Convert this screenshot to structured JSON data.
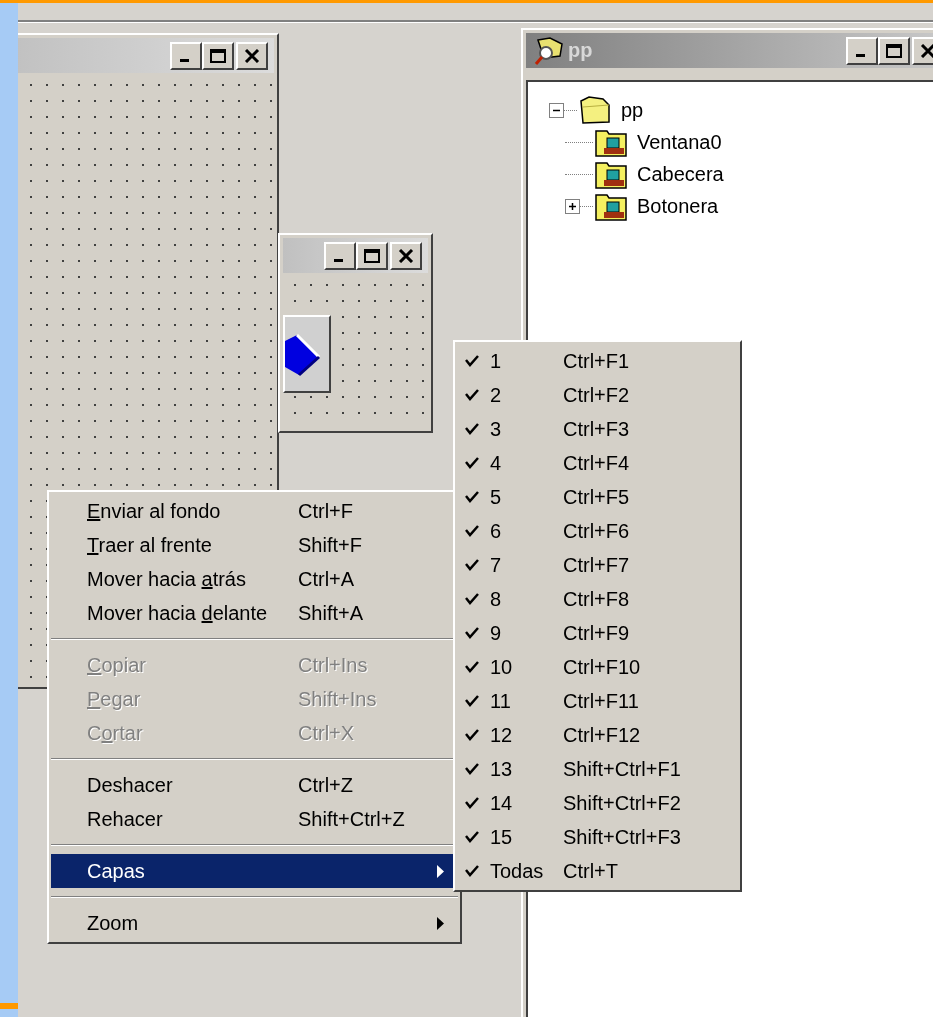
{
  "tree_window": {
    "title": "pp"
  },
  "tree": [
    {
      "label": "pp",
      "kind": "branch",
      "expanded": true,
      "children": [
        {
          "label": "Ventana0",
          "kind": "leaf"
        },
        {
          "label": "Cabecera",
          "kind": "leaf"
        },
        {
          "label": "Botonera",
          "kind": "branch",
          "expanded": false
        }
      ]
    }
  ],
  "menu": {
    "items": [
      {
        "kind": "item",
        "key": "E",
        "after": "nviar al fondo",
        "shortcut": "Ctrl+F",
        "disabled": false,
        "selected": false
      },
      {
        "kind": "item",
        "key": "T",
        "after": "raer al frente",
        "shortcut": "Shift+F",
        "disabled": false,
        "selected": false
      },
      {
        "kind": "item",
        "before": "Mover hacia ",
        "key": "a",
        "after": "trás",
        "shortcut": "Ctrl+A",
        "disabled": false,
        "selected": false
      },
      {
        "kind": "item",
        "before": "Mover hacia ",
        "key": "d",
        "after": "elante",
        "shortcut": "Shift+A",
        "disabled": false,
        "selected": false
      },
      {
        "kind": "separator"
      },
      {
        "kind": "item",
        "key": "C",
        "after": "opiar",
        "shortcut": "Ctrl+Ins",
        "disabled": true,
        "selected": false
      },
      {
        "kind": "item",
        "key": "P",
        "after": "egar",
        "shortcut": "Shift+Ins",
        "disabled": true,
        "selected": false
      },
      {
        "kind": "item",
        "before": "C",
        "key": "o",
        "after": "rtar",
        "shortcut": "Ctrl+X",
        "disabled": true,
        "selected": false
      },
      {
        "kind": "separator"
      },
      {
        "kind": "item",
        "label": "Deshacer",
        "shortcut": "Ctrl+Z",
        "disabled": false,
        "selected": false
      },
      {
        "kind": "item",
        "label": "Rehacer",
        "shortcut": "Shift+Ctrl+Z",
        "disabled": false,
        "selected": false
      },
      {
        "kind": "separator"
      },
      {
        "kind": "submenu",
        "label": "Capas",
        "disabled": false,
        "selected": true
      },
      {
        "kind": "separator"
      },
      {
        "kind": "submenu",
        "label": "Zoom",
        "disabled": false,
        "selected": false
      }
    ]
  },
  "submenu": {
    "items": [
      {
        "label": "1",
        "shortcut": "Ctrl+F1",
        "checked": true
      },
      {
        "label": "2",
        "shortcut": "Ctrl+F2",
        "checked": true
      },
      {
        "label": "3",
        "shortcut": "Ctrl+F3",
        "checked": true
      },
      {
        "label": "4",
        "shortcut": "Ctrl+F4",
        "checked": true
      },
      {
        "label": "5",
        "shortcut": "Ctrl+F5",
        "checked": true
      },
      {
        "label": "6",
        "shortcut": "Ctrl+F6",
        "checked": true
      },
      {
        "label": "7",
        "shortcut": "Ctrl+F7",
        "checked": true
      },
      {
        "label": "8",
        "shortcut": "Ctrl+F8",
        "checked": true
      },
      {
        "label": "9",
        "shortcut": "Ctrl+F9",
        "checked": true
      },
      {
        "label": "10",
        "shortcut": "Ctrl+F10",
        "checked": true
      },
      {
        "label": "11",
        "shortcut": "Ctrl+F11",
        "checked": true
      },
      {
        "label": "12",
        "shortcut": "Ctrl+F12",
        "checked": true
      },
      {
        "label": "13",
        "shortcut": "Shift+Ctrl+F1",
        "checked": true
      },
      {
        "label": "14",
        "shortcut": "Shift+Ctrl+F2",
        "checked": true
      },
      {
        "label": "15",
        "shortcut": "Shift+Ctrl+F3",
        "checked": true
      },
      {
        "label": "Todas",
        "shortcut": "Ctrl+T",
        "checked": true
      }
    ]
  }
}
